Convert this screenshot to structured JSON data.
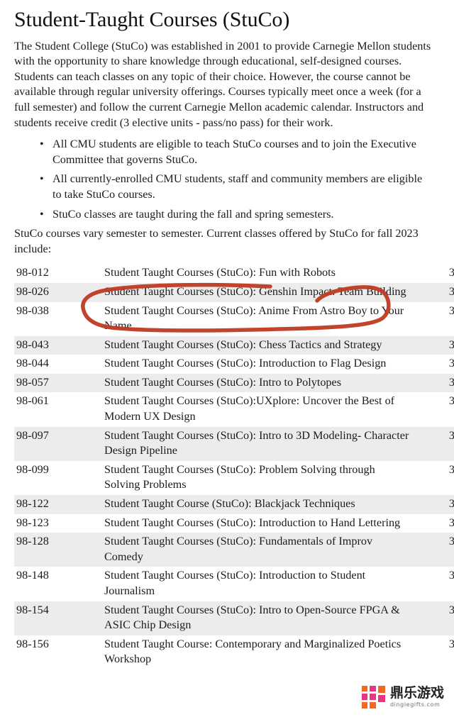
{
  "page": {
    "title": "Student-Taught Courses (StuCo)",
    "intro_paragraph": "The Student College (StuCo) was established in 2001 to provide Carnegie Mellon students with the opportunity to share knowledge through educational, self-designed courses. Students can teach classes on any topic of their choice. However, the course cannot be available through regular university offerings. Courses typically meet once a week (for a full semester) and follow the current Carnegie Mellon academic calendar. Instructors and students receive credit (3 elective units - pass/no pass) for their work.",
    "bullets": [
      "All CMU students are eligible to teach StuCo courses and to join the Executive Committee that governs StuCo.",
      "All currently-enrolled CMU students, staff and community members are eligible to take StuCo courses.",
      "StuCo classes are taught during the fall and spring semesters."
    ],
    "bullet_glyph": "•",
    "closing_paragraph": "StuCo courses vary semester to semester. Current classes offered by StuCo for fall 2023 include:"
  },
  "course_table": {
    "rows": [
      {
        "number": "98-012",
        "title": "Student Taught Courses (StuCo): Fun with Robots",
        "units": "3",
        "shaded": false
      },
      {
        "number": "98-026",
        "title": "Student Taught Courses (StuCo): Genshin Impact: Team Building",
        "units": "3",
        "shaded": true
      },
      {
        "number": "98-038",
        "title": "Student Taught Courses (StuCo): Anime From Astro Boy to Your Name",
        "units": "3",
        "shaded": false
      },
      {
        "number": "98-043",
        "title": "Student Taught Courses (StuCo): Chess Tactics and Strategy",
        "units": "3",
        "shaded": true
      },
      {
        "number": "98-044",
        "title": "Student Taught Courses (StuCo): Introduction to Flag Design",
        "units": "3",
        "shaded": false
      },
      {
        "number": "98-057",
        "title": "Student Taught Courses (StuCo): Intro to Polytopes",
        "units": "3",
        "shaded": true
      },
      {
        "number": "98-061",
        "title": "Student Taught Courses (StuCo):UXplore: Uncover the Best of Modern UX Design",
        "units": "3",
        "shaded": false
      },
      {
        "number": "98-097",
        "title": "Student Taught Courses (StuCo): Intro to 3D Modeling- Character Design Pipeline",
        "units": "3",
        "shaded": true
      },
      {
        "number": "98-099",
        "title": "Student Taught Courses (StuCo): Problem Solving through Solving Problems",
        "units": "3",
        "shaded": false
      },
      {
        "number": "98-122",
        "title": "Student Taught Course (StuCo): Blackjack Techniques",
        "units": "3",
        "shaded": true
      },
      {
        "number": "98-123",
        "title": "Student Taught Courses (StuCo): Introduction to Hand Lettering",
        "units": "3",
        "shaded": false
      },
      {
        "number": "98-128",
        "title": "Student Taught Courses (StuCo): Fundamentals of Improv Comedy",
        "units": "3",
        "shaded": true
      },
      {
        "number": "98-148",
        "title": "Student Taught Courses (StuCo): Introduction to Student Journalism",
        "units": "3",
        "shaded": false
      },
      {
        "number": "98-154",
        "title": "Student Taught Courses (StuCo): Intro to Open-Source FPGA & ASIC Chip Design",
        "units": "3",
        "shaded": true
      },
      {
        "number": "98-156",
        "title": "Student Taught Course: Contemporary and Marginalized Poetics Workshop",
        "units": "3",
        "shaded": false
      }
    ]
  },
  "annotation": {
    "kind": "hand-drawn-ellipse-highlight",
    "color": "#bf3a22",
    "targets_row_number": "98-026"
  },
  "watermark": {
    "brand_cn": "鼎乐游戏",
    "url": "dinglegifts.com",
    "colors": {
      "pink": "#e8357f",
      "orange": "#f26a21"
    }
  }
}
